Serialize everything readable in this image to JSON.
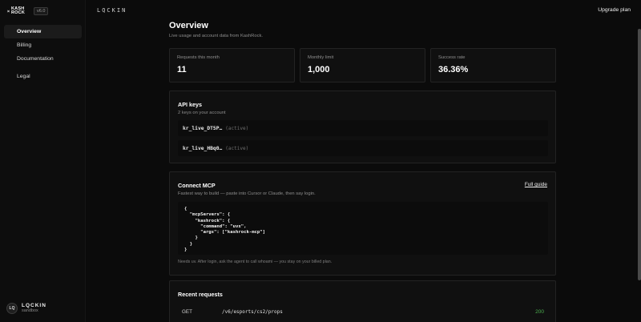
{
  "sidebar": {
    "brand_word_1": "KASH",
    "brand_word_2": "ROCK",
    "badge": "v6.0",
    "items": [
      {
        "label": "Overview",
        "active": true
      },
      {
        "label": "Billing"
      },
      {
        "label": "Documentation"
      },
      {
        "label": "Legal"
      }
    ],
    "user": {
      "initials": "LQ",
      "name": "LQCKIN",
      "env": "sandbox"
    }
  },
  "topbar": {
    "logo": "LQCKIN",
    "upgrade_label": "Upgrade plan"
  },
  "page": {
    "title": "Overview",
    "subtitle": "Live usage and account data from KashRock."
  },
  "stats": [
    {
      "label": "Requests this month",
      "value": "11"
    },
    {
      "label": "Monthly limit",
      "value": "1,000"
    },
    {
      "label": "Success rate",
      "value": "36.36%"
    }
  ],
  "api_keys": {
    "title": "API keys",
    "subtitle": "2 keys on your account",
    "keys": [
      {
        "id": "kr_live_DT5P…",
        "status": "(active)"
      },
      {
        "id": "kr_live_HBq0…",
        "status": "(active)"
      }
    ]
  },
  "mcp": {
    "title": "Connect MCP",
    "subtitle": "Fastest way to build — paste into Cursor or Claude, then say login.",
    "guide_label": "Full guide",
    "code": "{\n  \"mcpServers\": {\n    \"kashrock\": {\n      \"command\": \"uvx\",\n      \"args\": [\"kashrock-mcp\"]\n    }\n  }\n}",
    "note": "Needs uv. After login, ask the agent to call whoami — you stay on your billed plan."
  },
  "recent": {
    "title": "Recent requests",
    "rows": [
      {
        "method": "GET",
        "path": "/v6/esports/cs2/props",
        "status": "200"
      }
    ]
  },
  "colors": {
    "accent_success": "#4caf50",
    "background": "#0b0b0b",
    "card": "#101010"
  }
}
